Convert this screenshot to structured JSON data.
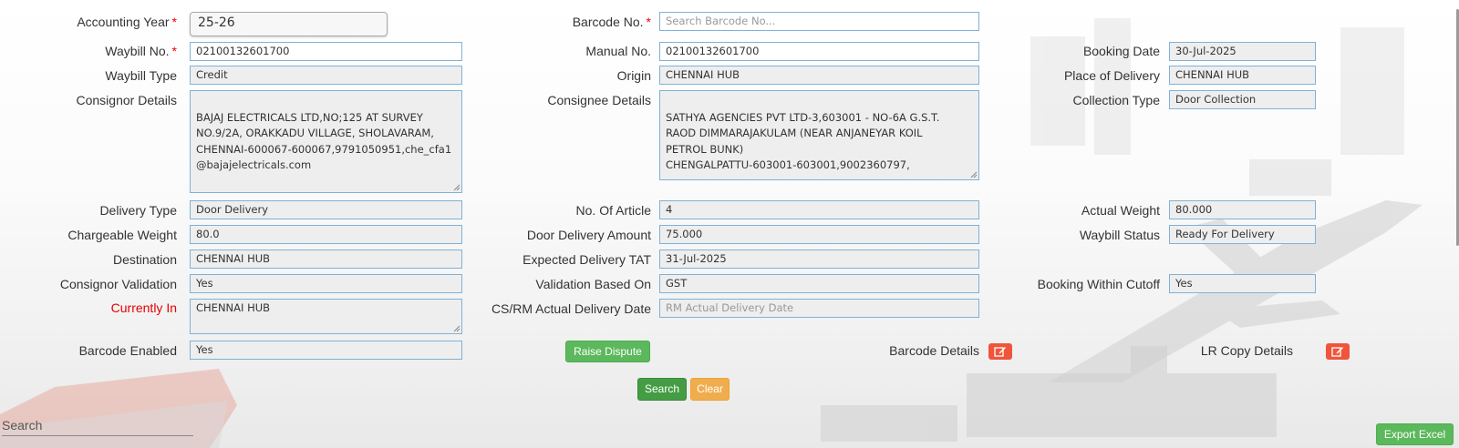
{
  "form": {
    "accounting_year": {
      "label": "Accounting Year",
      "value": "25-26"
    },
    "barcode_no": {
      "label": "Barcode No.",
      "placeholder": "Search Barcode No..."
    },
    "waybill_no": {
      "label": "Waybill No.",
      "value": "02100132601700"
    },
    "manual_no": {
      "label": "Manual No.",
      "value": "02100132601700"
    },
    "booking_date": {
      "label": "Booking Date",
      "value": "30-Jul-2025"
    },
    "waybill_type": {
      "label": "Waybill Type",
      "value": "Credit"
    },
    "origin": {
      "label": "Origin",
      "value": "CHENNAI HUB"
    },
    "place_of_delivery": {
      "label": "Place of Delivery",
      "value": "CHENNAI HUB"
    },
    "consignor_details": {
      "label": "Consignor Details",
      "value": "BAJAJ ELECTRICALS LTD,NO;125 AT SURVEY\nNO.9/2A, ORAKKADU VILLAGE, SHOLAVARAM,\nCHENNAI-600067-600067,9791050951,che_cfa1\n@bajajelectricals.com"
    },
    "consignee_details": {
      "label": "Consignee Details",
      "value": "SATHYA AGENCIES PVT LTD-3,603001 - NO-6A G.S.T.\nRAOD DIMMARAJAKULAM (NEAR ANJANEYAR KOIL\nPETROL BUNK)\nCHENGALPATTU-603001-603001,9002360797,"
    },
    "collection_type": {
      "label": "Collection Type",
      "value": "Door Collection"
    },
    "delivery_type": {
      "label": "Delivery Type",
      "value": "Door Delivery"
    },
    "no_of_article": {
      "label": "No. Of Article",
      "value": "4"
    },
    "actual_weight": {
      "label": "Actual Weight",
      "value": "80.000"
    },
    "chargeable_weight": {
      "label": "Chargeable Weight",
      "value": "80.0"
    },
    "door_delivery_amount": {
      "label": "Door Delivery Amount",
      "value": "75.000"
    },
    "waybill_status": {
      "label": "Waybill Status",
      "value": "Ready For Delivery"
    },
    "destination": {
      "label": "Destination",
      "value": "CHENNAI HUB"
    },
    "expected_delivery_tat": {
      "label": "Expected Delivery TAT",
      "value": "31-Jul-2025"
    },
    "consignor_validation": {
      "label": "Consignor Validation",
      "value": "Yes"
    },
    "validation_based_on": {
      "label": "Validation Based On",
      "value": "GST"
    },
    "booking_within_cutoff": {
      "label": "Booking Within Cutoff",
      "value": "Yes"
    },
    "currently_in": {
      "label": "Currently In",
      "value": "CHENNAI HUB"
    },
    "cs_rm_actual_delivery_date": {
      "label": "CS/RM Actual Delivery Date",
      "placeholder": "RM Actual Delivery Date"
    },
    "barcode_enabled": {
      "label": "Barcode Enabled",
      "value": "Yes"
    },
    "barcode_details": {
      "label": "Barcode Details"
    },
    "lr_copy_details": {
      "label": "LR Copy Details"
    }
  },
  "buttons": {
    "raise_dispute": "Raise Dispute",
    "search": "Search",
    "clear": "Clear",
    "export_excel": "Export Excel"
  },
  "table_search": {
    "placeholder": "Search"
  },
  "colors": {
    "required_star": "#ee0000",
    "currently_in_label": "#e60000",
    "field_border": "#7fb2d6",
    "edit_icon_bg": "#f0553c",
    "green_button": "#5cb85c",
    "orange_button": "#f0ad4e"
  },
  "icons": {
    "edit": "edit-icon",
    "resize": "resize-grip-icon"
  }
}
